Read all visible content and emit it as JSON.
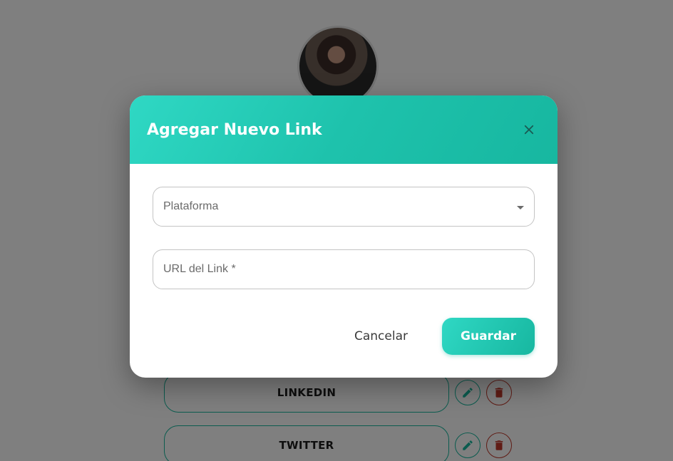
{
  "background": {
    "avatar_icon": "user-photo",
    "links": [
      {
        "label": "LINKEDIN"
      },
      {
        "label": "TWITTER"
      }
    ]
  },
  "dialog": {
    "title": "Agregar Nuevo Link",
    "platform_field": {
      "label": "Plataforma",
      "value": ""
    },
    "url_field": {
      "label": "URL del Link *",
      "value": ""
    },
    "cancel_label": "Cancelar",
    "save_label": "Guardar"
  },
  "colors": {
    "accent": "#1ec2ac",
    "accent_light": "#2fd8c4",
    "danger": "#c0392b"
  },
  "icons": {
    "close": "close-icon",
    "dropdown": "chevron-down-icon",
    "edit": "pencil-icon",
    "delete": "trash-icon"
  }
}
